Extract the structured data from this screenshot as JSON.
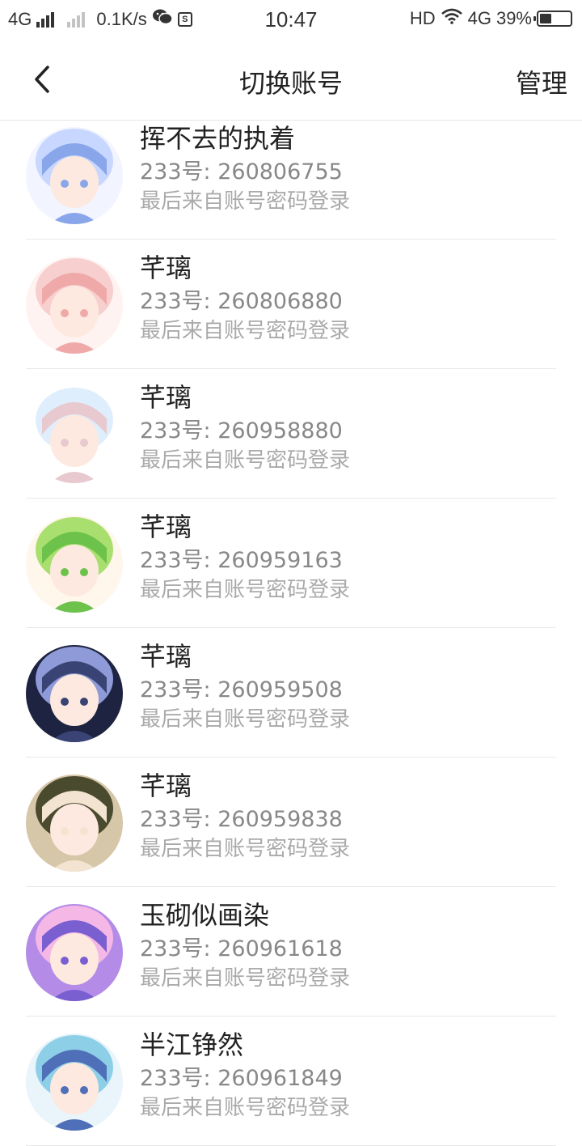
{
  "status_bar": {
    "signal1": "4G",
    "speed": "0.1K/s",
    "time": "10:47",
    "hd": "HD",
    "signal2": "4G",
    "battery": "39%",
    "battery_level": 0.39
  },
  "header": {
    "title": "切换账号",
    "manage_label": "管理"
  },
  "accounts": [
    {
      "name": "挥不去的执着",
      "uid": "233号: 260806755",
      "hint": "最后来自账号密码登录",
      "palette": [
        "#c7d7ff",
        "#8aa6ea",
        "#f2f4ff"
      ]
    },
    {
      "name": "芊璃",
      "uid": "233号: 260806880",
      "hint": "最后来自账号密码登录",
      "palette": [
        "#f7cfcf",
        "#f0a9a9",
        "#fff3f1"
      ]
    },
    {
      "name": "芊璃",
      "uid": "233号: 260958880",
      "hint": "最后来自账号密码登录",
      "palette": [
        "#dfeefc",
        "#e8c9cf",
        "#ffffff"
      ]
    },
    {
      "name": "芊璃",
      "uid": "233号: 260959163",
      "hint": "最后来自账号密码登录",
      "palette": [
        "#a9df6e",
        "#6cc24a",
        "#fff6ec"
      ]
    },
    {
      "name": "芊璃",
      "uid": "233号: 260959508",
      "hint": "最后来自账号密码登录",
      "palette": [
        "#8f9bd8",
        "#3a4474",
        "#1d2340"
      ]
    },
    {
      "name": "芊璃",
      "uid": "233号: 260959838",
      "hint": "最后来自账号密码登录",
      "palette": [
        "#4a4a2e",
        "#f3e3d1",
        "#d7c7a9"
      ]
    },
    {
      "name": "玉砌似画染",
      "uid": "233号: 260961618",
      "hint": "最后来自账号密码登录",
      "palette": [
        "#f4b7e6",
        "#7a5fd0",
        "#b48ce8"
      ]
    },
    {
      "name": "半江铮然",
      "uid": "233号: 260961849",
      "hint": "最后来自账号密码登录",
      "palette": [
        "#8ecfe8",
        "#4f6fb8",
        "#e9f4fb"
      ]
    }
  ]
}
